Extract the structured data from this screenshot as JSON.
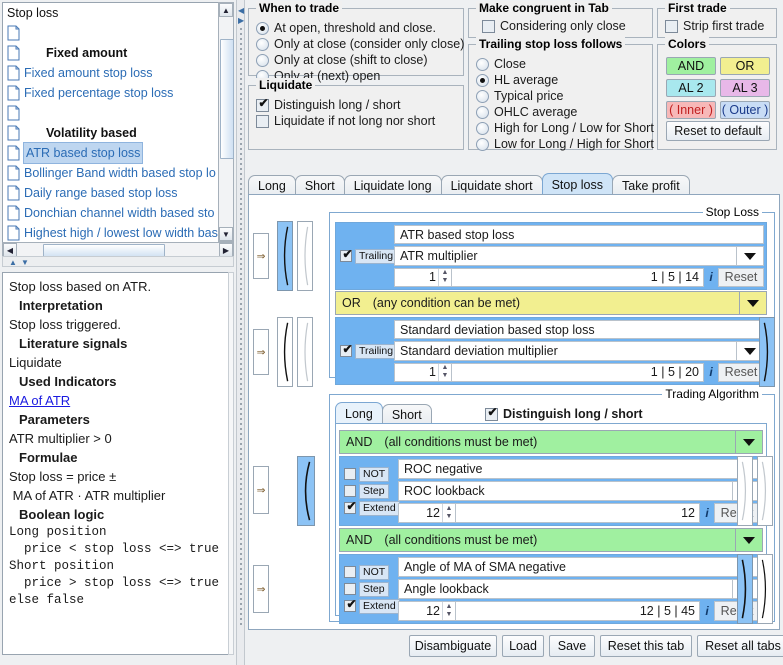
{
  "left": {
    "tree_title": "Stop loss",
    "items": [
      {
        "label": "",
        "kind": "blank"
      },
      {
        "label": "Fixed amount",
        "kind": "header"
      },
      {
        "label": "Fixed amount stop loss",
        "kind": "leaf"
      },
      {
        "label": "Fixed percentage stop loss",
        "kind": "leaf"
      },
      {
        "label": "",
        "kind": "blank"
      },
      {
        "label": "Volatility based",
        "kind": "header"
      },
      {
        "label": "ATR based stop loss",
        "kind": "selected"
      },
      {
        "label": "Bollinger Band width based stop lo",
        "kind": "leaf"
      },
      {
        "label": "Daily range based stop loss",
        "kind": "leaf"
      },
      {
        "label": "Donchian channel width based sto",
        "kind": "leaf"
      },
      {
        "label": "Highest high / lowest low width bas",
        "kind": "leaf"
      }
    ],
    "description": [
      {
        "text": "Stop loss based on ATR.",
        "style": "plain"
      },
      {
        "text": "Interpretation",
        "style": "bold"
      },
      {
        "text": "Stop loss triggered.",
        "style": "plain"
      },
      {
        "text": "Literature signals",
        "style": "bold"
      },
      {
        "text": "Liquidate",
        "style": "plain"
      },
      {
        "text": "Used Indicators",
        "style": "bold"
      },
      {
        "text": "MA of ATR",
        "style": "link"
      },
      {
        "text": "Parameters",
        "style": "bold"
      },
      {
        "text": "ATR multiplier > 0",
        "style": "plain"
      },
      {
        "text": "Formulae",
        "style": "bold"
      },
      {
        "text": "Stop loss = price ±",
        "style": "plain"
      },
      {
        "text": " MA of ATR · ATR multiplier",
        "style": "plain"
      },
      {
        "text": "Boolean logic",
        "style": "bold"
      },
      {
        "text": "Long position",
        "style": "mono"
      },
      {
        "text": "  price < stop loss <=> true",
        "style": "mono"
      },
      {
        "text": "Short position",
        "style": "mono"
      },
      {
        "text": "  price > stop loss <=> true",
        "style": "mono"
      },
      {
        "text": "else false",
        "style": "mono"
      }
    ]
  },
  "when_to_trade": {
    "title": "When to trade",
    "options": [
      {
        "label": "At open, threshold and close.",
        "selected": true
      },
      {
        "label": "Only at close (consider only close)",
        "selected": false
      },
      {
        "label": "Only at close (shift to close)",
        "selected": false
      },
      {
        "label": "Only at (next) open",
        "selected": false
      }
    ]
  },
  "liquidate": {
    "title": "Liquidate",
    "options": [
      {
        "label": "Distinguish long / short",
        "checked": true
      },
      {
        "label": "Liquidate if not long nor short",
        "checked": false
      }
    ]
  },
  "congruent": {
    "title": "Make congruent in Tab",
    "options": [
      {
        "label": "Considering only close",
        "checked": false
      }
    ]
  },
  "trailing_follows": {
    "title": "Trailing stop loss follows",
    "options": [
      {
        "label": "Close",
        "selected": false
      },
      {
        "label": "HL average",
        "selected": true
      },
      {
        "label": "Typical price",
        "selected": false
      },
      {
        "label": "OHLC average",
        "selected": false
      },
      {
        "label": "High for Long / Low for Short",
        "selected": false
      },
      {
        "label": "Low for Long / High for Short",
        "selected": false
      }
    ]
  },
  "first_trade": {
    "title": "First trade",
    "options": [
      {
        "label": "Strip first trade",
        "checked": false
      }
    ]
  },
  "colors": {
    "title": "Colors",
    "swatches": [
      {
        "label": "AND",
        "color": "#a0f0a0"
      },
      {
        "label": "OR",
        "color": "#f2ef90"
      },
      {
        "label": "AL 2",
        "color": "#a8e8ee"
      },
      {
        "label": "AL 3",
        "color": "#e8b8e8"
      },
      {
        "label": "( Inner )",
        "color": "#f7b8b8",
        "text_color": "#c02020"
      },
      {
        "label": "( Outer )",
        "color": "#c8dcf5",
        "text_color": "#1a3a8a"
      }
    ],
    "reset_label": "Reset to default"
  },
  "main_tabs": [
    {
      "label": "Long",
      "active": false
    },
    {
      "label": "Short",
      "active": false
    },
    {
      "label": "Liquidate long",
      "active": false
    },
    {
      "label": "Liquidate short",
      "active": false
    },
    {
      "label": "Stop loss",
      "active": true
    },
    {
      "label": "Take profit",
      "active": false
    }
  ],
  "stop_loss_group": {
    "title": "Stop Loss",
    "rows": [
      {
        "type": "condition",
        "flag_label": "Trailing",
        "flag_checked": true,
        "name": "ATR based stop loss",
        "param": "ATR multiplier",
        "value": "1",
        "hint": "1 | 5 | 14",
        "info_label": "i",
        "reset_label": "Reset"
      },
      {
        "type": "operator",
        "label": "OR",
        "detail": "(any condition can be met)",
        "color": "#f2ef90"
      },
      {
        "type": "condition",
        "flag_label": "Trailing",
        "flag_checked": true,
        "name": "Standard deviation based stop loss",
        "param": "Standard deviation multiplier",
        "value": "1",
        "hint": "1 | 5 | 20",
        "info_label": "i",
        "reset_label": "Reset"
      }
    ]
  },
  "trading_algorithm_group": {
    "title": "Trading Algorithm",
    "tabs": [
      {
        "label": "Long",
        "active": true
      },
      {
        "label": "Short",
        "active": false
      }
    ],
    "distinguish_label": "Distinguish long / short",
    "distinguish_checked": true,
    "rows": [
      {
        "type": "operator",
        "label": "AND",
        "detail": "(all conditions must be met)",
        "color": "#a0f0a0"
      },
      {
        "type": "condition",
        "checks": [
          {
            "label": "NOT",
            "checked": false
          },
          {
            "label": "Step",
            "checked": false
          },
          {
            "label": "Extend",
            "checked": true
          }
        ],
        "name": "ROC negative",
        "param": "ROC lookback",
        "value": "12",
        "hint": "12",
        "info_label": "i",
        "reset_label": "Reset"
      },
      {
        "type": "operator",
        "label": "AND",
        "detail": "(all conditions must be met)",
        "color": "#a0f0a0"
      },
      {
        "type": "condition",
        "checks": [
          {
            "label": "NOT",
            "checked": false
          },
          {
            "label": "Step",
            "checked": false
          },
          {
            "label": "Extend",
            "checked": true
          }
        ],
        "name": "Angle of MA of SMA negative",
        "param": "Angle lookback",
        "value": "12",
        "hint": "12 | 5 | 45",
        "info_label": "i",
        "reset_label": "Reset"
      }
    ]
  },
  "bottom_buttons": [
    {
      "label": "Disambiguate"
    },
    {
      "label": "Load"
    },
    {
      "label": "Save"
    },
    {
      "label": "Reset this tab"
    },
    {
      "label": "Reset all tabs"
    }
  ]
}
